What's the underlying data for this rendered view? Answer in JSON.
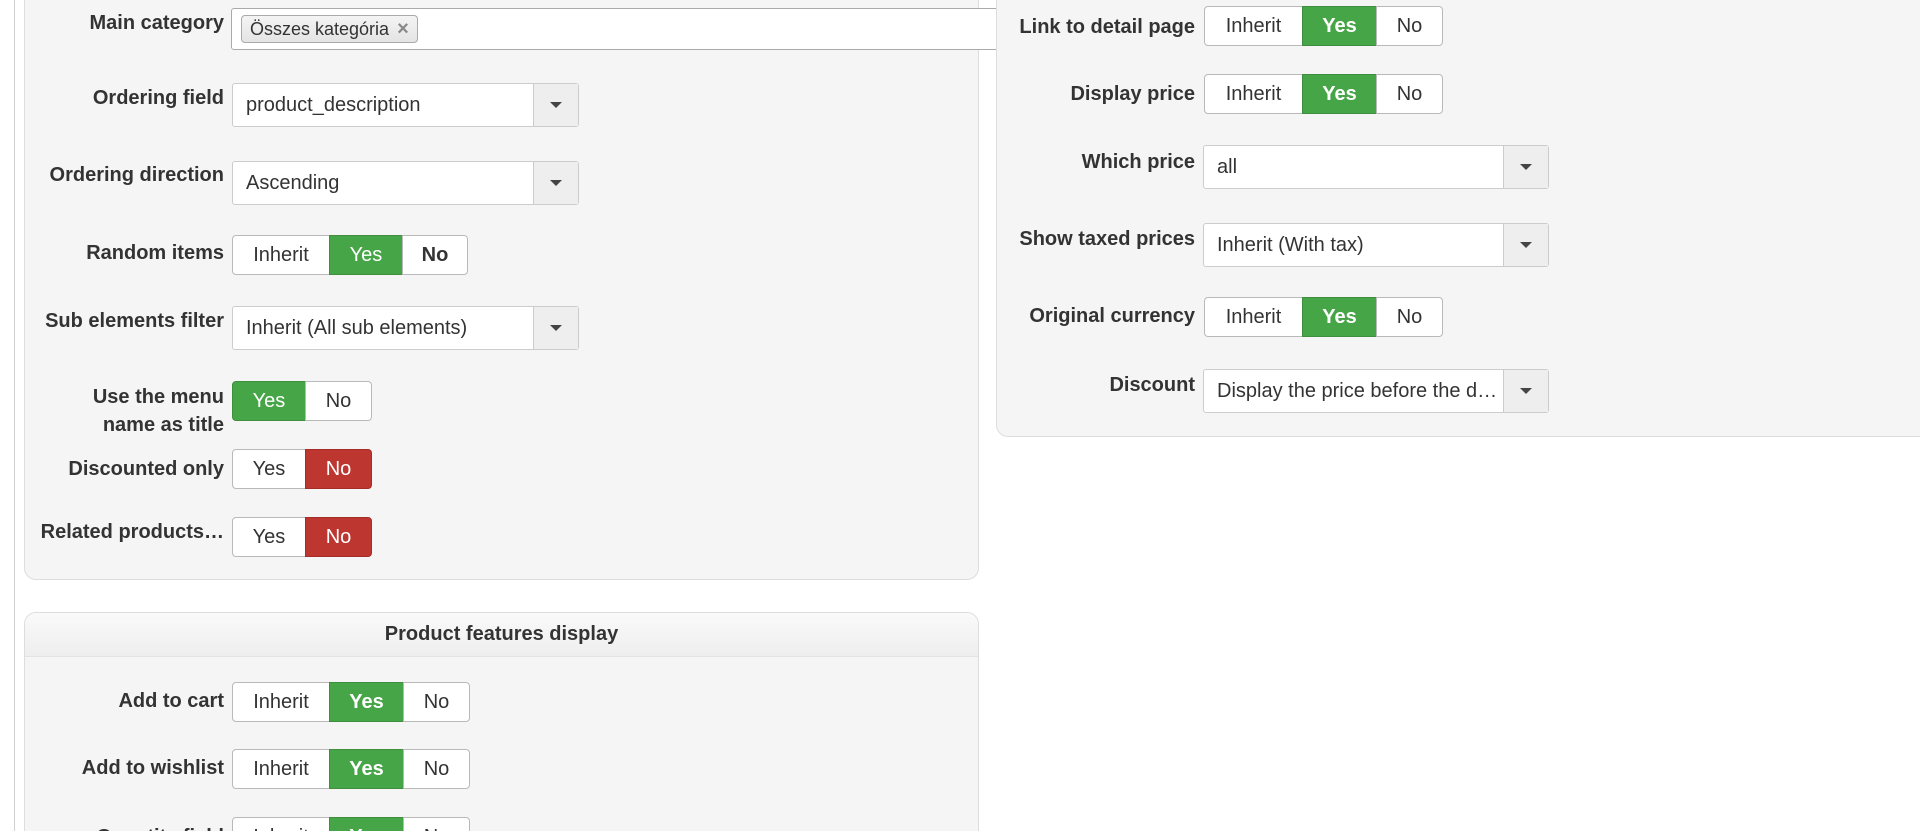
{
  "general": {
    "main_category": {
      "label": "Main category",
      "chip": "Összes kategória",
      "remove_icon": "×"
    },
    "ordering_field": {
      "label": "Ordering field",
      "value": "product_description"
    },
    "ordering_direction": {
      "label": "Ordering direction",
      "value": "Ascending"
    },
    "random_items": {
      "label": "Random items",
      "options": [
        "Inherit",
        "Yes",
        "No"
      ],
      "selected": "Yes"
    },
    "sub_elements_filter": {
      "label": "Sub elements filter",
      "value": "Inherit (All sub elements)"
    },
    "use_menu_name": {
      "label_line1": "Use the menu",
      "label_line2": "name as title",
      "options": [
        "Yes",
        "No"
      ],
      "selected": "Yes"
    },
    "discounted_only": {
      "label": "Discounted only",
      "options": [
        "Yes",
        "No"
      ],
      "selected": "No"
    },
    "related_products": {
      "label": "Related products…",
      "options": [
        "Yes",
        "No"
      ],
      "selected": "No"
    }
  },
  "features": {
    "title": "Product features display",
    "add_to_cart": {
      "label": "Add to cart",
      "options": [
        "Inherit",
        "Yes",
        "No"
      ],
      "selected": "Yes"
    },
    "add_to_wishlist": {
      "label": "Add to wishlist",
      "options": [
        "Inherit",
        "Yes",
        "No"
      ],
      "selected": "Yes"
    },
    "quantity_field": {
      "label": "Quantity field",
      "options": [
        "Inherit",
        "Yes",
        "No"
      ],
      "selected": "Yes"
    }
  },
  "price": {
    "link_to_detail": {
      "label": "Link to detail page",
      "options": [
        "Inherit",
        "Yes",
        "No"
      ],
      "selected": "Yes"
    },
    "display_price": {
      "label": "Display price",
      "options": [
        "Inherit",
        "Yes",
        "No"
      ],
      "selected": "Yes"
    },
    "which_price": {
      "label": "Which price",
      "value": "all"
    },
    "show_taxed": {
      "label": "Show taxed prices",
      "value": "Inherit (With tax)"
    },
    "original_currency": {
      "label": "Original currency",
      "options": [
        "Inherit",
        "Yes",
        "No"
      ],
      "selected": "Yes"
    },
    "discount": {
      "label": "Discount",
      "value": "Display the price before the d…"
    }
  },
  "colors": {
    "yes_active": "#46a546",
    "no_active": "#bd362f",
    "panel_bg": "#f5f5f5"
  },
  "icons": {
    "dropdown": "caret-down-icon",
    "chip_remove": "close-icon"
  }
}
